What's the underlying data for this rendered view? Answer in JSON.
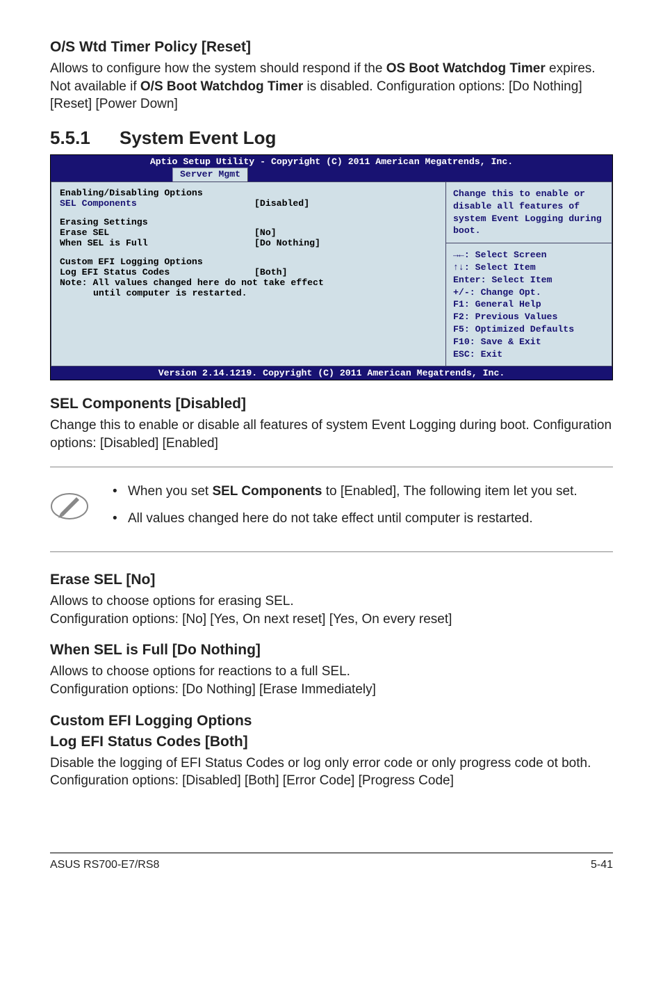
{
  "s1": {
    "title": "O/S Wtd Timer Policy [Reset]",
    "p1a": "Allows to configure how the system should respond if the ",
    "p1b": "OS Boot Watchdog Timer",
    "p1c": " expires. Not available if ",
    "p1d": "O/S Boot Watchdog Timer",
    "p1e": " is disabled. Configuration options: [Do Nothing] [Reset] [Power Down]"
  },
  "sec": {
    "num": "5.5.1",
    "title": "System Event Log"
  },
  "bios": {
    "title_line": "Aptio Setup Utility - Copyright (C) 2011 American Megatrends, Inc.",
    "tab": "Server Mgmt",
    "grp1": "Enabling/Disabling Options",
    "r1l": "SEL Components",
    "r1v": "[Disabled]",
    "grp2": "Erasing Settings",
    "r2l": "Erase SEL",
    "r2v": "[No]",
    "r3l": "When SEL is Full",
    "r3v": "[Do Nothing]",
    "grp3": "Custom EFI Logging Options",
    "r4l": "Log EFI Status Codes",
    "r4v": "[Both]",
    "note1": "Note: All values changed here do not take effect",
    "note2": "until computer is restarted.",
    "help": "Change this to enable or disable all features of system Event Logging during boot.",
    "nav1": "→←: Select Screen",
    "nav2": "↑↓:  Select Item",
    "nav3": "Enter: Select Item",
    "nav4": "+/-: Change Opt.",
    "nav5": "F1: General Help",
    "nav6": "F2: Previous Values",
    "nav7": "F5: Optimized Defaults",
    "nav8": "F10: Save & Exit",
    "nav9": "ESC: Exit",
    "footer": "Version 2.14.1219. Copyright (C) 2011 American Megatrends, Inc."
  },
  "s2": {
    "title": "SEL Components [Disabled]",
    "p": "Change this to enable or disable all features of system Event Logging during boot. Configuration options: [Disabled] [Enabled]"
  },
  "notes": {
    "li1a": "When you set ",
    "li1b": "SEL Components",
    "li1c": " to [Enabled], The following item let you set.",
    "li2": "All values changed here do not take effect until computer is restarted."
  },
  "s3": {
    "title": "Erase SEL [No]",
    "p": "Allows to choose options for erasing SEL.\nConfiguration options: [No] [Yes, On next reset] [Yes, On every reset]"
  },
  "s4": {
    "title": "When SEL is Full [Do Nothing]",
    "p": "Allows to choose options for reactions to a full SEL.\nConfiguration options: [Do Nothing] [Erase Immediately]"
  },
  "s5": {
    "title": "Custom EFI Logging Options",
    "sub": "Log EFI Status Codes [Both]",
    "p": "Disable the logging of EFI Status Codes or log only error code or only progress code ot both. Configuration options: [Disabled] [Both] [Error Code] [Progress Code]"
  },
  "footer": {
    "left": "ASUS RS700-E7/RS8",
    "right": "5-41"
  }
}
